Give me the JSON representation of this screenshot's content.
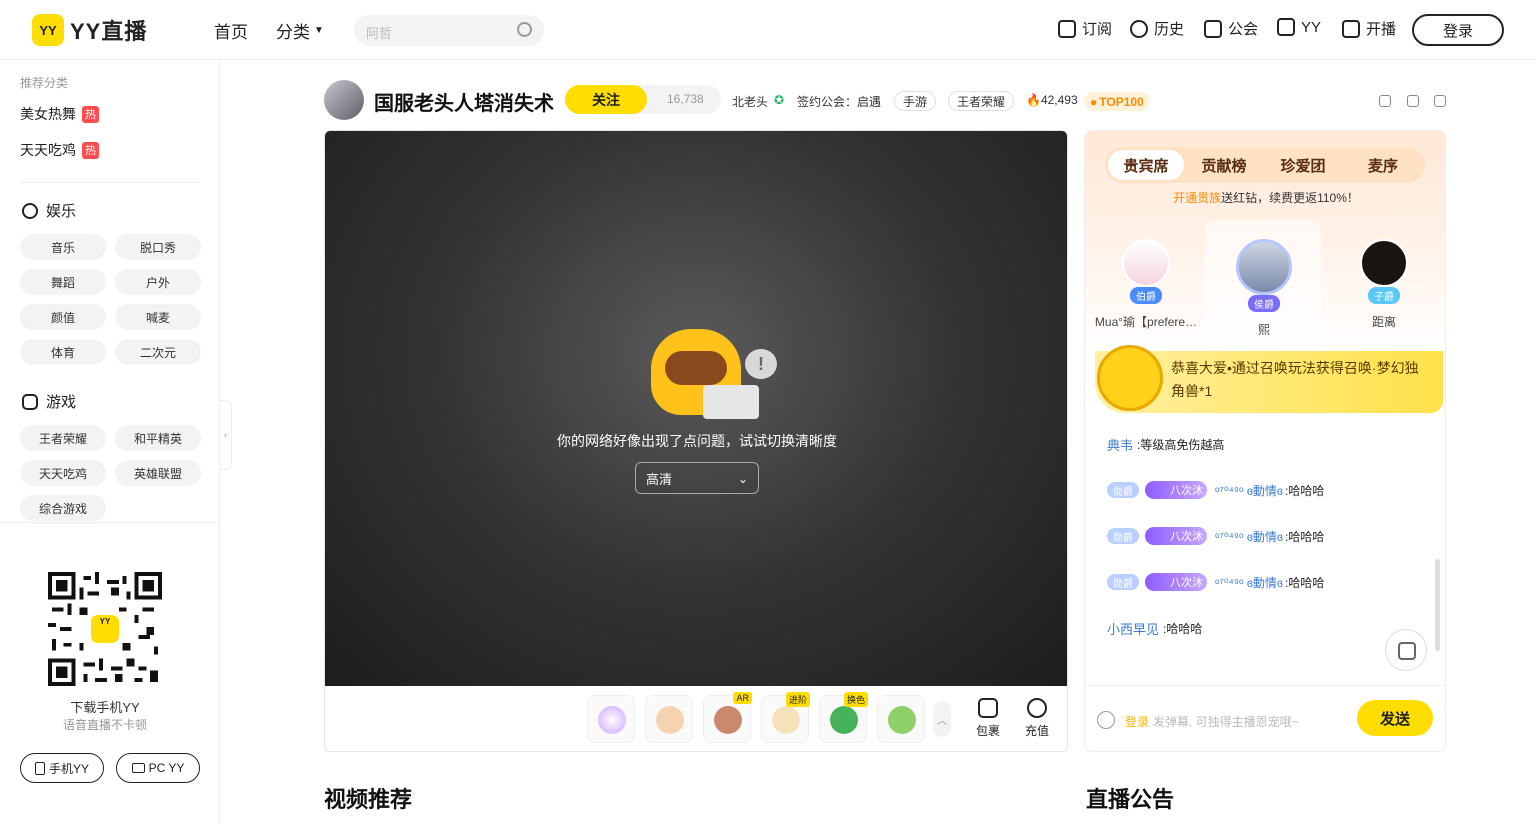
{
  "header": {
    "logo_mark": "YY",
    "logo_text": "YY直播",
    "nav": [
      "首页",
      "分类"
    ],
    "search_placeholder": "阿哲",
    "actions": [
      "订阅",
      "历史",
      "公会",
      "YY",
      "开播"
    ],
    "login": "登录"
  },
  "sidebar": {
    "recommend_label": "推荐分类",
    "recommend": [
      "美女热舞",
      "天天吃鸡"
    ],
    "hot_badge": "热",
    "entertainment": {
      "title": "娱乐",
      "items": [
        "音乐",
        "脱口秀",
        "舞蹈",
        "户外",
        "颜值",
        "喊麦",
        "体育",
        "二次元"
      ]
    },
    "games": {
      "title": "游戏",
      "items": [
        "王者荣耀",
        "和平精英",
        "天天吃鸡",
        "英雄联盟",
        "综合游戏"
      ]
    },
    "qr_logo": "YY",
    "download_title": "下载手机YY",
    "download_sub": "语音直播不卡顿",
    "app_buttons": [
      "手机YY",
      "PC YY"
    ]
  },
  "room": {
    "title": "国服老头人塔消失术",
    "follow": "关注",
    "follow_count": "16,738",
    "anchor": "北老头",
    "guild": "签约公会：启遇",
    "tags": [
      "手游",
      "王者荣耀"
    ],
    "heat": "42,493",
    "rank_badge": "TOP100"
  },
  "player": {
    "error_message": "你的网络好像出现了点问题，试试切换清晰度",
    "quality": "高清",
    "bubble": "!",
    "gift_tags": [
      "AR",
      "进阶",
      "换色"
    ],
    "tools": [
      "包裹",
      "充值"
    ]
  },
  "panel": {
    "tabs": [
      "贵宾席",
      "贡献榜",
      "珍爱团",
      "麦序"
    ],
    "noble_prefix": "开通贵族",
    "noble_text": "送红钻，续费更返110%！",
    "ranks": [
      {
        "name": "Mua°瑜【prefere…",
        "badge": "伯爵"
      },
      {
        "name": "熙",
        "badge": "侯爵"
      },
      {
        "name": "距离",
        "badge": "子爵"
      }
    ],
    "banner_text": "恭喜大爱•通过召唤玩法获得召唤·梦幻独角兽*1",
    "chat": [
      {
        "name": "典韦",
        "text": ":等级高免伤越高"
      },
      {
        "level": "勋爵",
        "badge": "八次沐",
        "name": "ᵒ⁷⁰⁴⁹ᵒ ɞ動情ɞ",
        "text": ":哈哈哈"
      },
      {
        "level": "勋爵",
        "badge": "八次沐",
        "name": "ᵒ⁷⁰⁴⁹ᵒ ɞ動情ɞ",
        "text": ":哈哈哈"
      },
      {
        "level": "勋爵",
        "badge": "八次沐",
        "name": "ᵒ⁷⁰⁴⁹ᵒ ɞ動情ɞ",
        "text": ":哈哈哈"
      },
      {
        "name": "小西早见",
        "text": ":哈哈哈"
      }
    ],
    "input_login": "登录",
    "input_placeholder": "发弹幕, 可独得主播恩宠哦~",
    "send": "发送"
  },
  "sections": [
    "视频推荐",
    "直播公告"
  ]
}
